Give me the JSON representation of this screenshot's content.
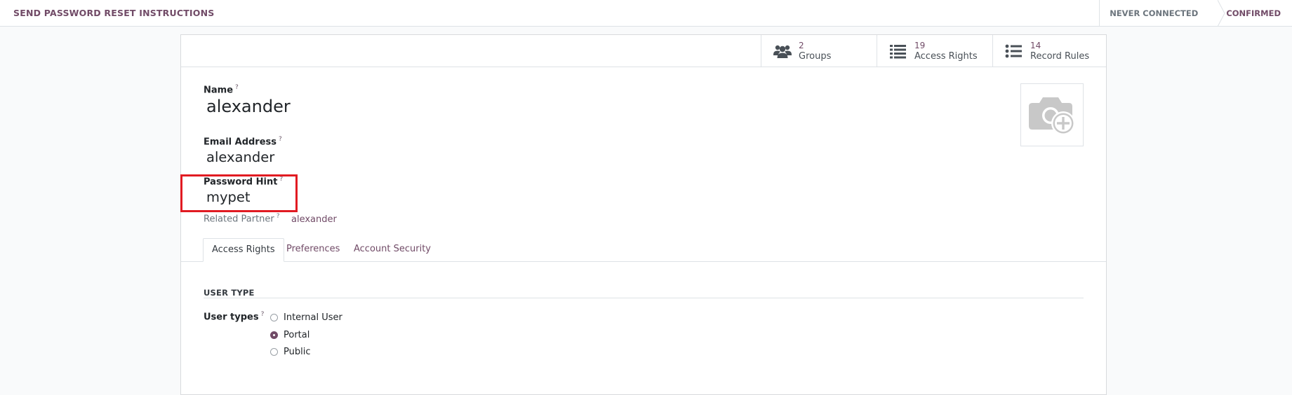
{
  "control_bar": {
    "reset_button": "SEND PASSWORD RESET INSTRUCTIONS",
    "status_steps": [
      "NEVER CONNECTED",
      "CONFIRMED"
    ],
    "current_status": "CONFIRMED"
  },
  "smart_buttons": [
    {
      "value": "2",
      "label": "Groups",
      "icon": "users-icon"
    },
    {
      "value": "19",
      "label": "Access Rights",
      "icon": "list-icon"
    },
    {
      "value": "14",
      "label": "Record Rules",
      "icon": "list-ul-icon"
    }
  ],
  "form": {
    "name_label": "Name",
    "name_value": "alexander",
    "email_label": "Email Address",
    "email_value": "alexander",
    "hint_label": "Password Hint",
    "hint_value": "mypet",
    "partner_label": "Related Partner",
    "partner_value": "alexander",
    "help_mark": "?"
  },
  "tabs": [
    {
      "label": "Access Rights",
      "active": true
    },
    {
      "label": "Preferences",
      "active": false
    },
    {
      "label": "Account Security",
      "active": false
    }
  ],
  "access_rights": {
    "section_title": "USER TYPE",
    "user_types_label": "User types",
    "options": [
      {
        "label": "Internal User",
        "checked": false
      },
      {
        "label": "Portal",
        "checked": true
      },
      {
        "label": "Public",
        "checked": false
      }
    ]
  },
  "colors": {
    "brand": "#714b67",
    "highlight": "#e11b22"
  }
}
